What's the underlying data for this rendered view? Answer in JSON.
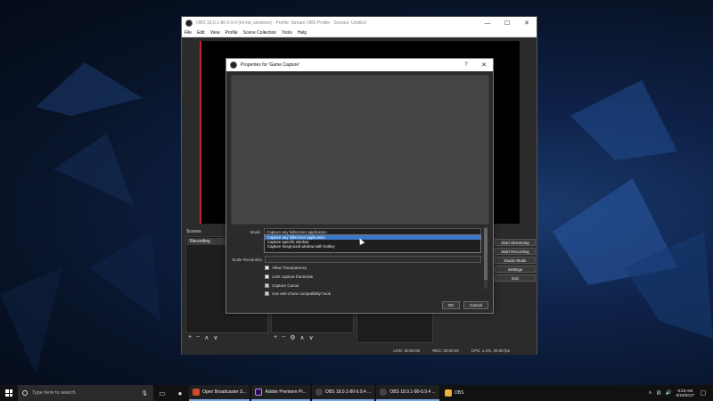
{
  "obs": {
    "title": "OBS 18.0.1-80-0.9.4 (64-bit, windows) - Profile: Stream OBS Profile - Scenes: Untitled",
    "menu": [
      "File",
      "Edit",
      "View",
      "Profile",
      "Scene Collection",
      "Tools",
      "Help"
    ],
    "scenes_label": "Scenes",
    "scene_item": "Recording",
    "toolbar": [
      "+",
      "−",
      "∧",
      "∨"
    ],
    "sources_toolbar": [
      "+",
      "−",
      "⚙",
      "∧",
      "∨"
    ],
    "controls": [
      "Start Streaming",
      "Start Recording",
      "Studio Mode",
      "Settings",
      "Exit"
    ],
    "status": {
      "live": "LIVE: 00:00:00",
      "rec": "REC: 00:00:00",
      "cpu": "CPU: 1.4%, 30.00 fps"
    }
  },
  "dialog": {
    "title": "Properties for 'Game Capture'",
    "help": "?",
    "close": "✕",
    "mode_label": "Mode",
    "mode_value": "Capture any fullscreen application",
    "mode_options": [
      "Capture any fullscreen application",
      "Capture specific window",
      "Capture foreground window with hotkey"
    ],
    "scale_label": "Scale Resolution",
    "scale_value": "",
    "checkboxes": [
      {
        "label": "Allow Transparency",
        "checked": false
      },
      {
        "label": "Limit capture framerate",
        "checked": false
      },
      {
        "label": "Capture Cursor",
        "checked": true
      },
      {
        "label": "Use anti-cheat compatibility hook",
        "checked": true
      }
    ],
    "ok": "OK",
    "cancel": "Cancel"
  },
  "taskbar": {
    "search_placeholder": "Type here to search",
    "tasks": [
      {
        "label": "Open Broadcaster S...",
        "color": "#d04a2a"
      },
      {
        "label": "Adobe Premiere Pr...",
        "color": "#2a0f4f"
      },
      {
        "label": "OBS 18.0.1-80-0.9.4 ...",
        "color": "#444444"
      },
      {
        "label": "OBS 18.0.1-80-0.9.4 ...",
        "color": "#444444"
      },
      {
        "label": "OBS",
        "color": "#e8b53a"
      }
    ],
    "time": "9:23 AM",
    "date": "5/18/2017"
  },
  "colors": {
    "accent": "#3a78c8",
    "preview_border": "#c0223b"
  }
}
